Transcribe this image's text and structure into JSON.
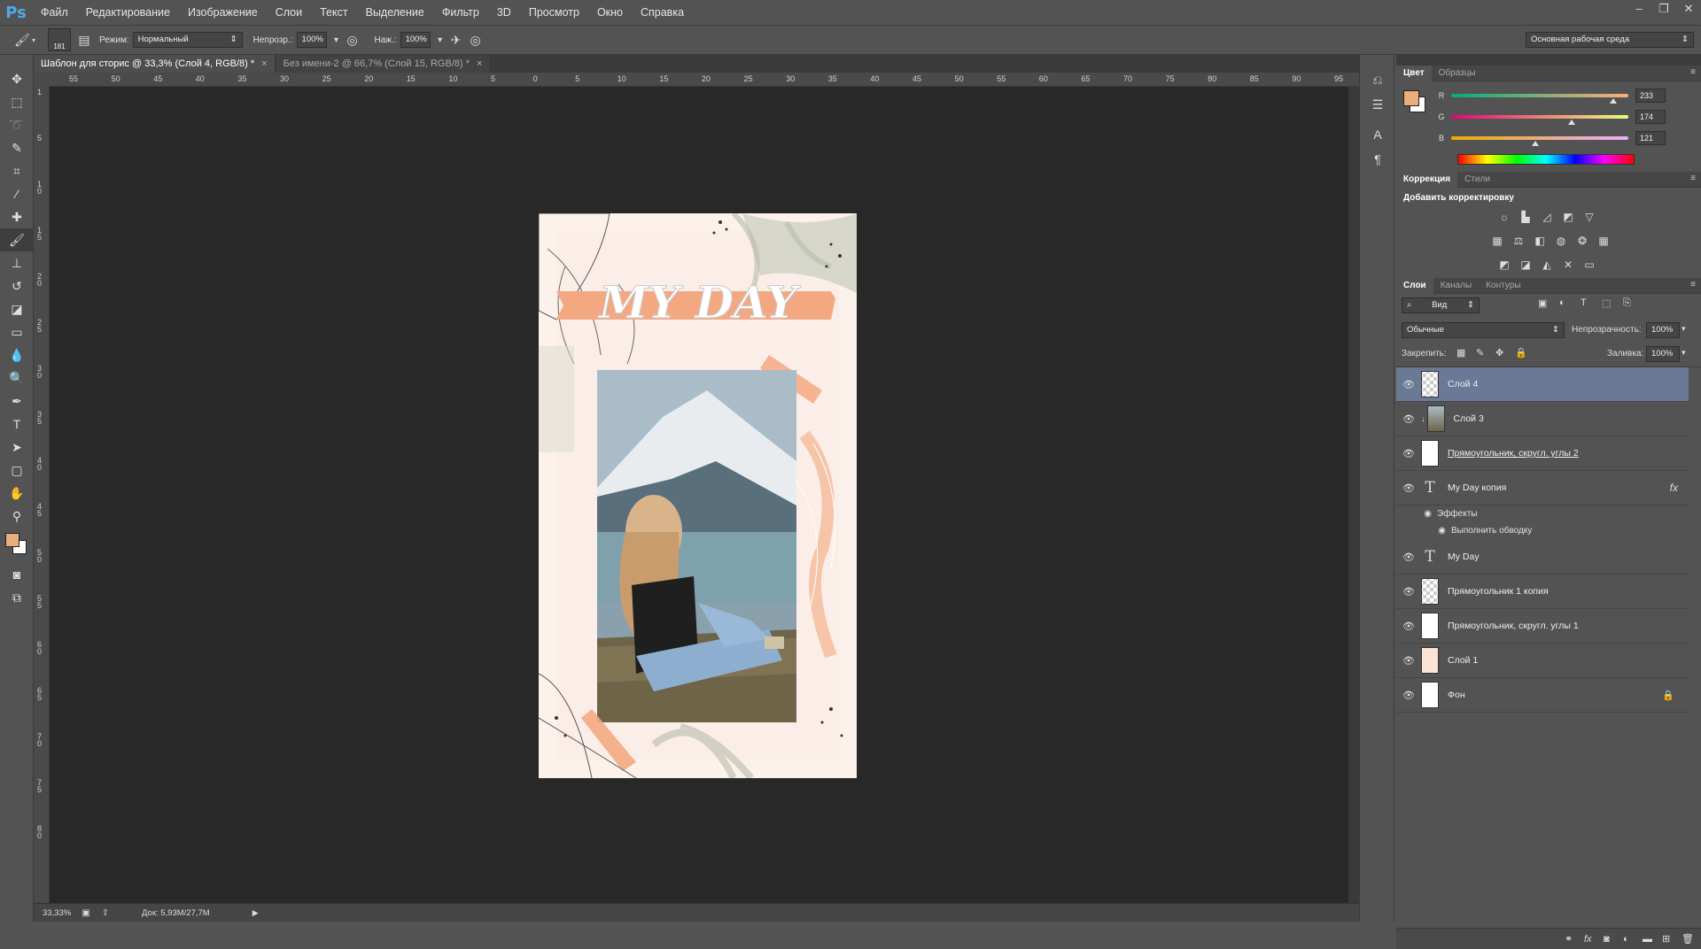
{
  "app": {
    "logo": "Ps"
  },
  "menu": [
    "Файл",
    "Редактирование",
    "Изображение",
    "Слои",
    "Текст",
    "Выделение",
    "Фильтр",
    "3D",
    "Просмотр",
    "Окно",
    "Справка"
  ],
  "window_controls": [
    "–",
    "❐",
    "✕"
  ],
  "options": {
    "brush_size": "181",
    "mode_label": "Режим:",
    "mode_value": "Нормальный",
    "opacity_label": "Непрозр.:",
    "opacity_value": "100%",
    "pressure_label": "Наж.:",
    "pressure_value": "100%",
    "workspace": "Основная рабочая среда"
  },
  "tabs": [
    {
      "label": "Шаблон для сторис @ 33,3% (Слой 4, RGB/8) *",
      "close": "×"
    },
    {
      "label": "Без имени-2 @ 66,7% (Слой 15, RGB/8) *",
      "close": "×"
    }
  ],
  "ruler": {
    "h_labels": [
      "55",
      "50",
      "45",
      "40",
      "35",
      "30",
      "25",
      "20",
      "15",
      "10",
      "5",
      "0",
      "5",
      "10",
      "15",
      "20",
      "25",
      "30",
      "35",
      "40",
      "45",
      "50",
      "55",
      "60",
      "65",
      "70",
      "75",
      "80",
      "85",
      "90",
      "95"
    ],
    "v_labels": [
      "1",
      "5",
      "1 0",
      "1 5",
      "2 0",
      "2 5",
      "3 0",
      "3 5",
      "4 0",
      "4 5",
      "5 0",
      "5 5",
      "6 0",
      "6 5",
      "7 0",
      "7 5",
      "8 0"
    ]
  },
  "artwork": {
    "title": "MY DAY"
  },
  "status": {
    "zoom": "33,33%",
    "doc": "Док: 5,93M/27,7M"
  },
  "color_panel": {
    "tabs": [
      "Цвет",
      "Образцы"
    ],
    "r_label": "R",
    "r": "233",
    "g_label": "G",
    "g": "174",
    "b_label": "B",
    "b": "121",
    "r_frac": 0.914,
    "g_frac": 0.682,
    "b_frac": 0.475,
    "fg_color": "#e9ae79",
    "bg_color": "#ffffff"
  },
  "adjust_panel": {
    "tabs": [
      "Коррекция",
      "Стили"
    ],
    "heading": "Добавить корректировку"
  },
  "layers_panel": {
    "tabs": [
      "Слои",
      "Каналы",
      "Контуры"
    ],
    "filter_label": "Вид",
    "blend_mode": "Обычные",
    "opacity_label": "Непрозрачность:",
    "opacity": "100%",
    "lock_label": "Закрепить:",
    "fill_label": "Заливка:",
    "fill": "100%",
    "layers": [
      {
        "name": "Слой 4",
        "selected": true
      },
      {
        "name": "Слой 3"
      },
      {
        "name": "Прямоугольник, скругл. углы 2"
      },
      {
        "name": "My Day копия",
        "fx": "fx"
      },
      {
        "name": "My Day"
      },
      {
        "name": "Прямоугольник 1 копия"
      },
      {
        "name": "Прямоугольник, скругл. углы 1"
      },
      {
        "name": "Слой 1"
      },
      {
        "name": "Фон"
      }
    ],
    "effects_label": "Эффекты",
    "stroke_label": "Выполнить обводку"
  }
}
